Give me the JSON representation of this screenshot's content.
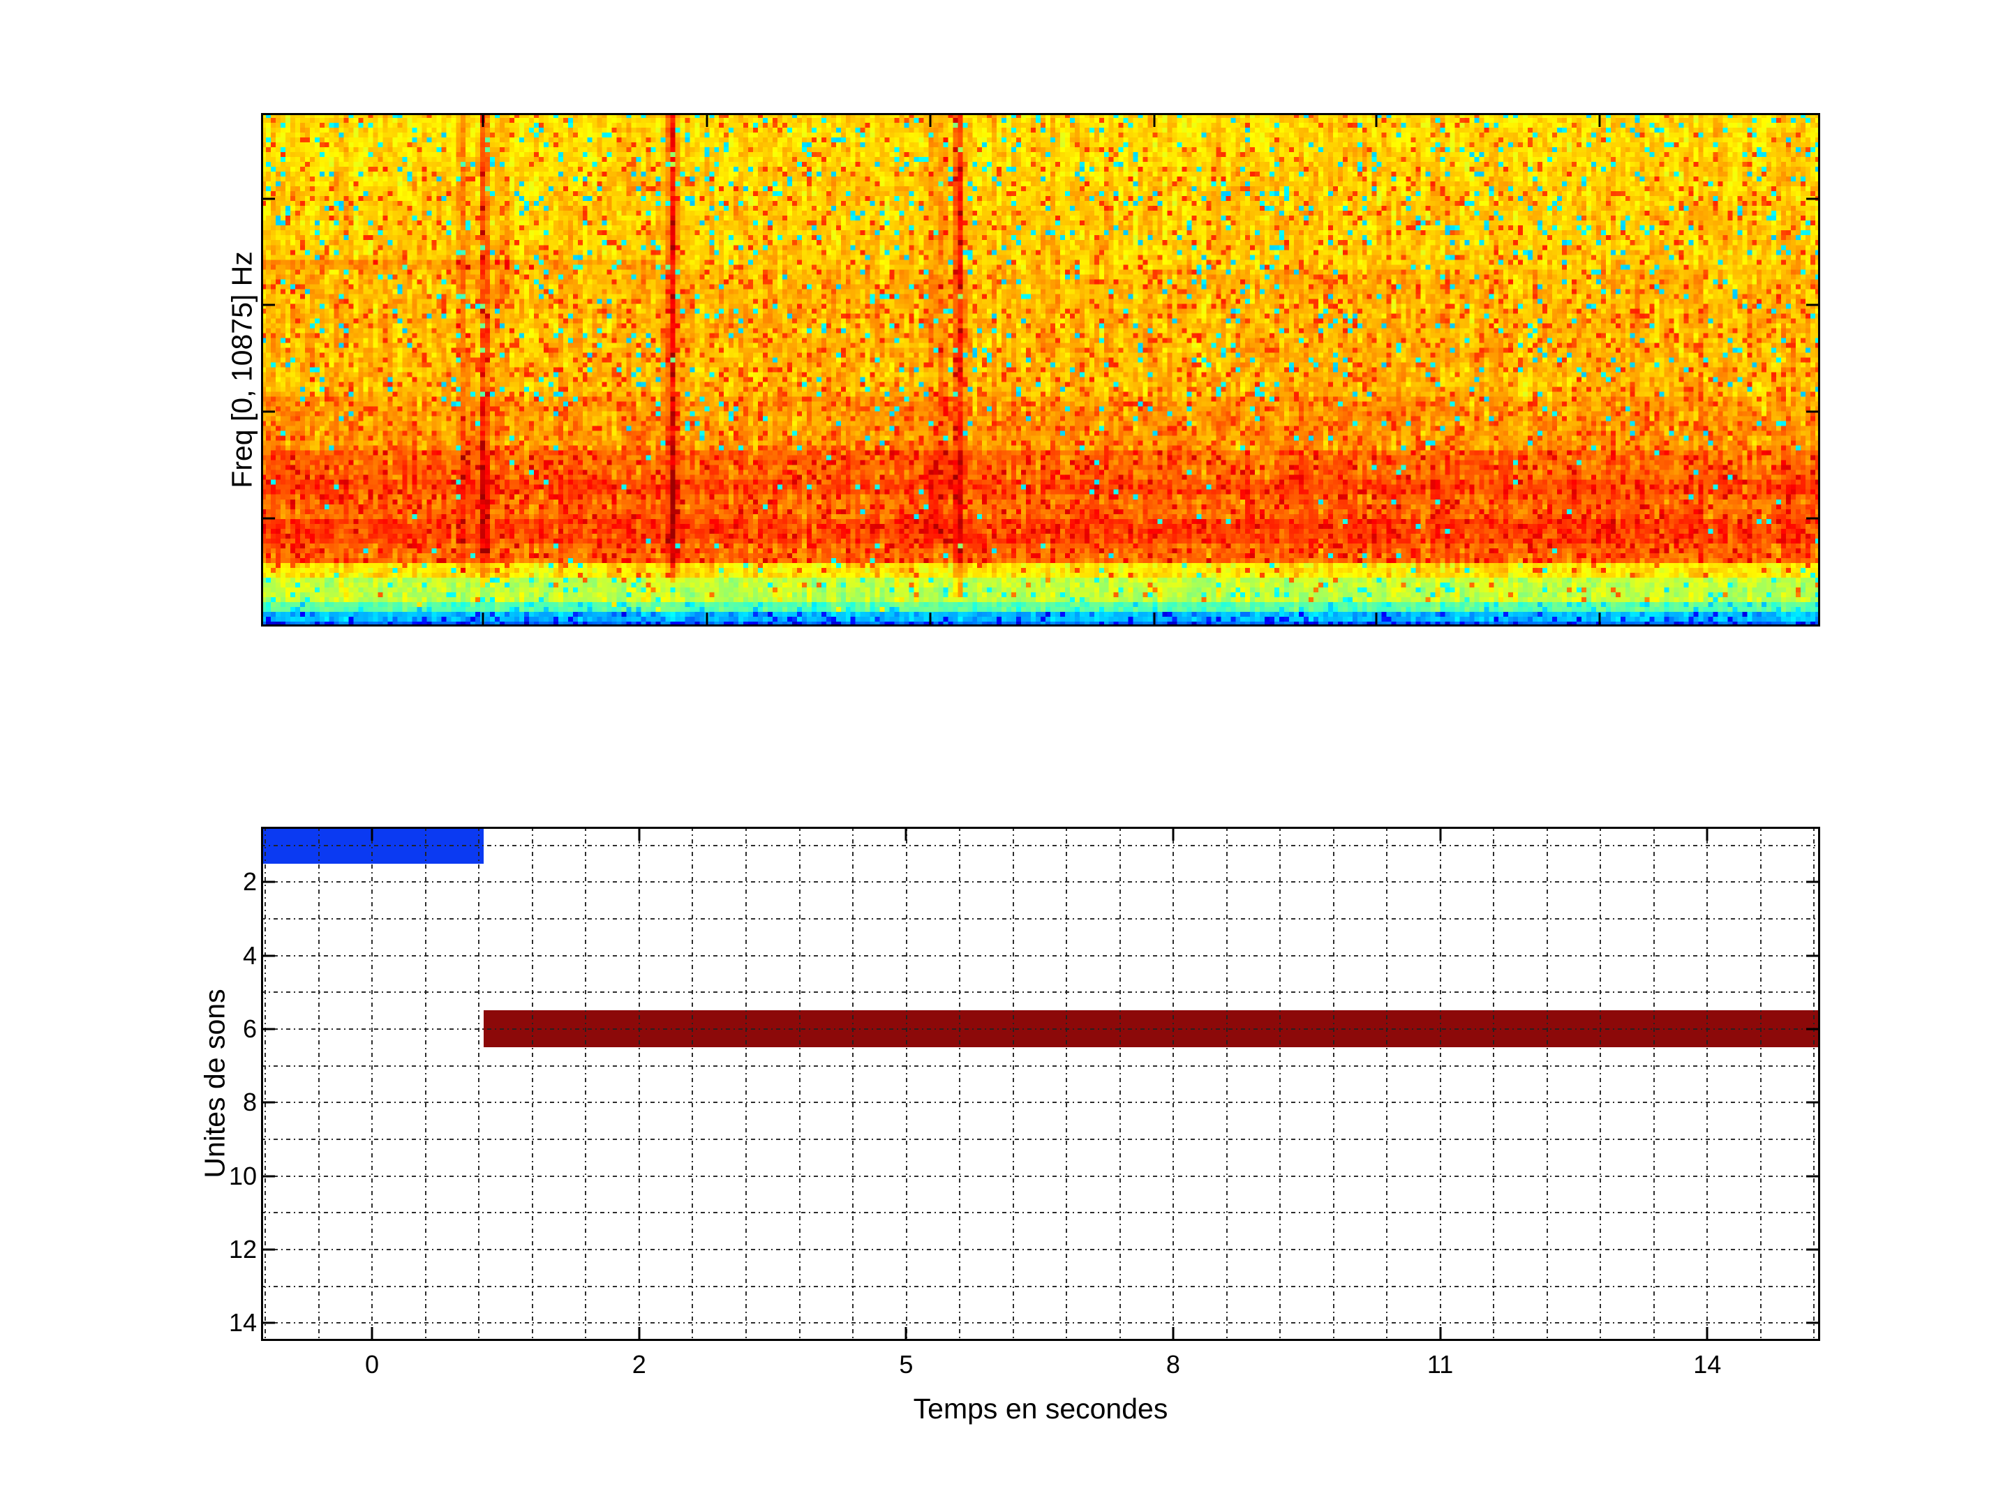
{
  "figure": {
    "background": "#ffffff",
    "title": ""
  },
  "colors": {
    "spine": "#000000",
    "grid": "#222222",
    "bar_blue": "#0b3af2",
    "bar_dark_red": "#8c0909",
    "tick_text": "#000000"
  },
  "chart_data": [
    {
      "type": "heatmap",
      "title": "",
      "xlabel": "",
      "ylabel": "Freq [0, 10875] Hz",
      "legend": "none",
      "grid": false,
      "colormap": "jet",
      "description": "audio spectrogram, mostly yellow-orange noise, horizontal orange energy band in lower third, green-cyan low band at bottom, several red vertical transients",
      "x_tick_fracs": [
        0.1423,
        0.286,
        0.4293,
        0.573,
        0.7153,
        0.8586
      ],
      "y_tick_fracs": [
        0.1671,
        0.3736,
        0.5815,
        0.7894
      ],
      "texture": {
        "cols": 320,
        "rows": 105,
        "seed": 1337,
        "profile": [
          {
            "until": 0.1,
            "mean": 0.665,
            "sd": 0.042,
            "cyan_p": 0.06,
            "cyan_v": 0.36,
            "hot_p": 0.05,
            "hot_v": 0.78
          },
          {
            "until": 0.3,
            "mean": 0.675,
            "sd": 0.045,
            "cyan_p": 0.055,
            "cyan_v": 0.35,
            "hot_p": 0.07,
            "hot_v": 0.79
          },
          {
            "until": 0.55,
            "mean": 0.695,
            "sd": 0.048,
            "cyan_p": 0.045,
            "cyan_v": 0.35,
            "hot_p": 0.1,
            "hot_v": 0.795
          },
          {
            "until": 0.66,
            "mean": 0.725,
            "sd": 0.05,
            "cyan_p": 0.03,
            "cyan_v": 0.36,
            "hot_p": 0.12,
            "hot_v": 0.8
          },
          {
            "until": 0.875,
            "mean": 0.775,
            "sd": 0.052,
            "cyan_p": 0.012,
            "cyan_v": 0.38,
            "hot_p": 0.1,
            "hot_v": 0.865
          },
          {
            "until": 0.912,
            "mean": 0.645,
            "sd": 0.05,
            "cyan_p": 0.02,
            "cyan_v": 0.4,
            "hot_p": 0.04,
            "hot_v": 0.78
          },
          {
            "until": 0.952,
            "mean": 0.565,
            "sd": 0.048,
            "cyan_p": 0.05,
            "cyan_v": 0.38,
            "hot_p": 0.02,
            "hot_v": 0.74
          },
          {
            "until": 0.972,
            "mean": 0.46,
            "sd": 0.04,
            "cyan_p": 0.1,
            "cyan_v": 0.34,
            "hot_p": 0.005,
            "hot_v": 0.6
          },
          {
            "until": 0.991,
            "mean": 0.315,
            "sd": 0.035,
            "cyan_p": 0.1,
            "cyan_v": 0.25,
            "dark_p": 0.1,
            "dark_v": 0.1
          },
          {
            "until": 1.01,
            "mean": 0.24,
            "sd": 0.03,
            "cyan_p": 0.0,
            "cyan_v": 0.25,
            "dark_p": 0.3,
            "dark_v": 0.07
          }
        ],
        "substripes": [
          {
            "from": 0.715,
            "to": 0.745,
            "boost": 0.03
          },
          {
            "from": 0.79,
            "to": 0.845,
            "boost": 0.038
          }
        ],
        "left_streak": {
          "fy": 0.295,
          "half": 0.01,
          "max_xfrac": 0.26,
          "boost": 0.05
        },
        "vertical_lines": [
          {
            "frac": 0.1276,
            "amp": 0.11,
            "wcells": 1.6,
            "fy_to": 0.9
          },
          {
            "frac": 0.1419,
            "amp": 0.2,
            "wcells": 1.4,
            "fy_to": 0.93
          },
          {
            "frac": 0.2623,
            "amp": 0.2,
            "wcells": 1.4,
            "fy_to": 0.92
          },
          {
            "frac": 0.4342,
            "amp": 0.08,
            "wcells": 2.5,
            "fy_to": 0.85
          },
          {
            "frac": 0.4458,
            "amp": 0.22,
            "wcells": 1.4,
            "fy_to": 0.95
          }
        ]
      }
    },
    {
      "type": "heatmap",
      "title": "",
      "xlabel": "Temps en secondes",
      "ylabel": "Unites de sons",
      "legend": "none",
      "grid": true,
      "grid_style": "dash-dot black, minor grid on both axes",
      "rows": 14,
      "ylim": [
        0.5,
        14.5
      ],
      "x_ticks": [
        {
          "label": "0",
          "frac": 0.0712
        },
        {
          "label": "2",
          "frac": 0.2425
        },
        {
          "label": "5",
          "frac": 0.4138
        },
        {
          "label": "8",
          "frac": 0.585
        },
        {
          "label": "11",
          "frac": 0.7563
        },
        {
          "label": "14",
          "frac": 0.9276
        }
      ],
      "y_ticks": [
        {
          "label": "2",
          "frac": 0.1077
        },
        {
          "label": "4",
          "frac": 0.2506
        },
        {
          "label": "6",
          "frac": 0.3935
        },
        {
          "label": "8",
          "frac": 0.5364
        },
        {
          "label": "10",
          "frac": 0.6793
        },
        {
          "label": "12",
          "frac": 0.8222
        },
        {
          "label": "14",
          "frac": 0.9651
        }
      ],
      "x_minor_grid": {
        "start_frac": 0.00282,
        "step_frac": 0.034254,
        "count": 30
      },
      "y_grid": {
        "start_frac": 0.03623,
        "step_frac": 0.07145,
        "count": 14
      },
      "segments": [
        {
          "name": "sound-unit-1",
          "row": 1,
          "x_start_frac": 0.0,
          "x_end_frac": 0.1428,
          "color": "#0b3af2"
        },
        {
          "name": "sound-unit-6",
          "row": 6,
          "x_start_frac": 0.1428,
          "x_end_frac": 1.0,
          "color": "#8c0909"
        }
      ]
    }
  ]
}
